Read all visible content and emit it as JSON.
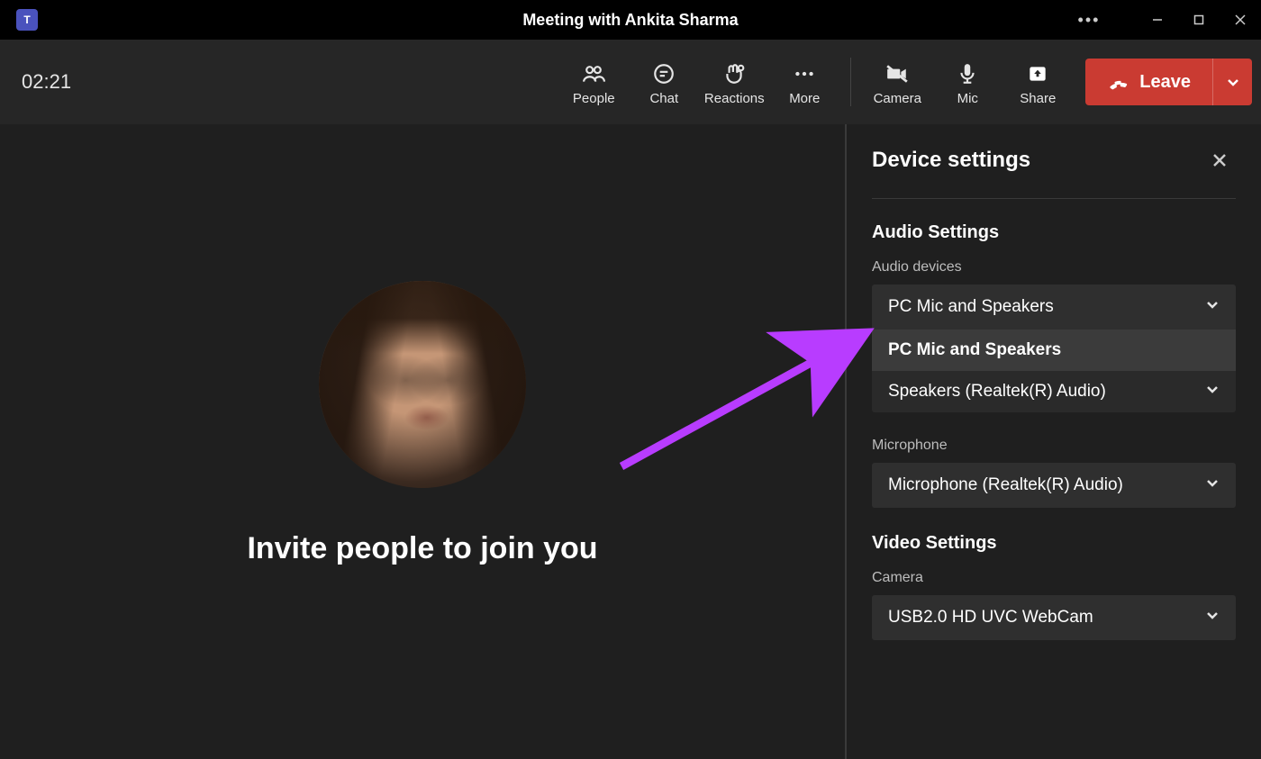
{
  "titlebar": {
    "title": "Meeting with Ankita Sharma"
  },
  "controlbar": {
    "timer": "02:21",
    "buttons": {
      "people": "People",
      "chat": "Chat",
      "reactions": "Reactions",
      "more": "More",
      "camera": "Camera",
      "mic": "Mic",
      "share": "Share"
    },
    "leave": "Leave"
  },
  "stage": {
    "invite_text": "Invite people to join you"
  },
  "panel": {
    "title": "Device settings",
    "audio": {
      "section_title": "Audio Settings",
      "devices_label": "Audio devices",
      "devices_selected": "PC Mic and Speakers",
      "devices_options": {
        "opt0": "PC Mic and Speakers",
        "opt1": "Speakers (Realtek(R) Audio)"
      },
      "mic_label": "Microphone",
      "mic_selected": "Microphone (Realtek(R) Audio)"
    },
    "video": {
      "section_title": "Video Settings",
      "camera_label": "Camera",
      "camera_selected": "USB2.0 HD UVC WebCam"
    }
  }
}
